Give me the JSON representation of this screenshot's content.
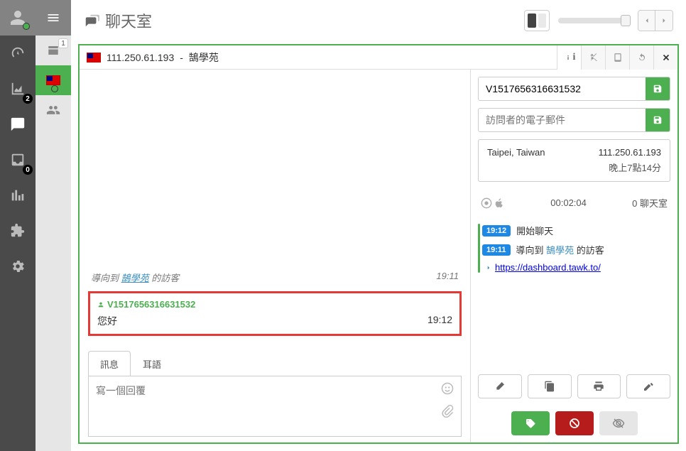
{
  "header": {
    "title": "聊天室"
  },
  "nav": {
    "badge_analytics": "2",
    "badge_inbox": "0"
  },
  "subnav": {
    "badge_count": "1"
  },
  "chat": {
    "visitor_ip": "111.250.61.193",
    "visitor_site": "鵠學苑",
    "separator": " - ",
    "system_msg_prefix": "導向到 ",
    "system_msg_link": "鵠學苑",
    "system_msg_suffix": " 的訪客",
    "system_time": "19:11",
    "user_name": "V1517656316631532",
    "user_msg": "您好",
    "user_time": "19:12",
    "tabs": {
      "message": "訊息",
      "whisper": "耳語"
    },
    "reply_placeholder": "寫一個回覆"
  },
  "panel": {
    "visitor_id": "V1517656316631532",
    "email_placeholder": "訪問者的電子郵件",
    "location": "Taipei, Taiwan",
    "ip": "111.250.61.193",
    "local_time": "晚上7點14分",
    "duration": "00:02:04",
    "chat_count": "0 聊天室",
    "events": [
      {
        "time": "19:12",
        "text": "開始聊天"
      },
      {
        "time": "19:11",
        "prefix": "導向到 ",
        "link": "鵠學苑",
        "suffix": " 的訪客"
      }
    ],
    "referrer_url": "https://dashboard.tawk.to/"
  }
}
